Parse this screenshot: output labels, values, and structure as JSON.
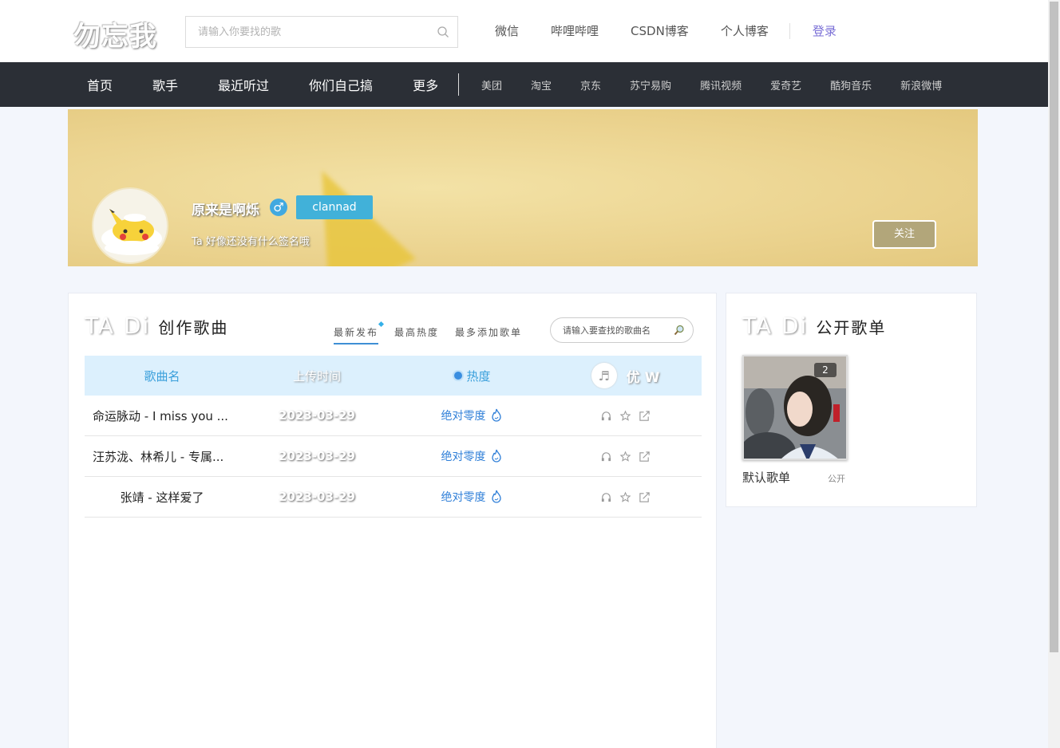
{
  "header": {
    "logo": "勿忘我",
    "search_placeholder": "请输入你要找的歌",
    "links": [
      "微信",
      "哔哩哔哩",
      "CSDN博客",
      "个人博客"
    ],
    "login": "登录"
  },
  "nav": {
    "main": [
      "首页",
      "歌手",
      "最近听过",
      "你们自己搞",
      "更多"
    ],
    "external": [
      "美团",
      "淘宝",
      "京东",
      "苏宁易购",
      "腾讯视频",
      "爱奇艺",
      "酷狗音乐",
      "新浪微博"
    ]
  },
  "profile": {
    "name": "原来是啊烁",
    "gender_symbol": "♂",
    "tag": "clannad",
    "signature": "Ta 好像还没有什么签名哦",
    "follow": "关注"
  },
  "songs": {
    "title_en": "TA Di",
    "title_cn": "创作歌曲",
    "tabs": [
      "最新发布",
      "最高热度",
      "最多添加歌单"
    ],
    "search_placeholder": "请输入要查找的歌曲名",
    "headers": {
      "name": "歌曲名",
      "upload": "上传时间",
      "heat": "热度",
      "user": "优 W"
    },
    "rows": [
      {
        "name": "命运脉动 - I miss you ...",
        "date": "2023-03-29",
        "heat": "绝对零度"
      },
      {
        "name": "汪苏泷、林希儿 - 专属...",
        "date": "2023-03-29",
        "heat": "绝对零度"
      },
      {
        "name": "张靖 - 这样爱了",
        "date": "2023-03-29",
        "heat": "绝对零度"
      }
    ]
  },
  "playlists": {
    "title_en": "TA Di",
    "title_cn": "公开歌单",
    "items": [
      {
        "count": "2",
        "name": "默认歌单",
        "visibility": "公开"
      }
    ]
  },
  "colors": {
    "nav_bg": "#2b2f36",
    "accent_blue": "#3a9fdb",
    "tag_blue": "#41b1d9",
    "follow_btn": "#b2a67a",
    "login": "#7a6fd6"
  }
}
